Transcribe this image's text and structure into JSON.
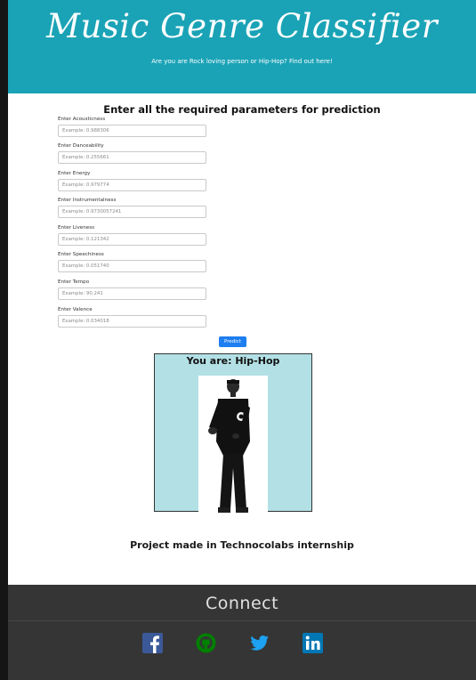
{
  "header": {
    "title": "Music Genre Classifier",
    "subtitle": "Are you are Rock loving person or Hip-Hop? Find out here!"
  },
  "form": {
    "heading": "Enter all the required parameters for prediction",
    "fields": [
      {
        "label": "Enter Acousticness",
        "placeholder": "Example: 0.988306"
      },
      {
        "label": "Enter Danceability",
        "placeholder": "Example: 0.255661"
      },
      {
        "label": "Enter Energy",
        "placeholder": "Example: 0.979774"
      },
      {
        "label": "Enter Instrumentalness",
        "placeholder": "Example: 0.9730057241"
      },
      {
        "label": "Enter Liveness",
        "placeholder": "Example: 0.121342"
      },
      {
        "label": "Enter Speechiness",
        "placeholder": "Example: 0.051740"
      },
      {
        "label": "Enter Tempo",
        "placeholder": "Example: 90.241"
      },
      {
        "label": "Enter Valence",
        "placeholder": "Example: 0.034018"
      }
    ],
    "predict_label": "Predict"
  },
  "result": {
    "text": "You are: Hip-Hop",
    "image_icon": "hip-hop-artist-photo"
  },
  "credit": "Project made in Technocolabs internship",
  "footer": {
    "title": "Connect",
    "social": [
      {
        "name": "facebook-icon",
        "color": "#3b5998"
      },
      {
        "name": "github-icon",
        "color": "#008000"
      },
      {
        "name": "twitter-icon",
        "color": "#1da1f2"
      },
      {
        "name": "linkedin-icon",
        "color": "#0077b5"
      }
    ]
  },
  "colors": {
    "header_bg": "#1aa3b6",
    "result_bg": "#b2e0e5",
    "button_bg": "#1e7ef0",
    "footer_bg": "#353535"
  }
}
